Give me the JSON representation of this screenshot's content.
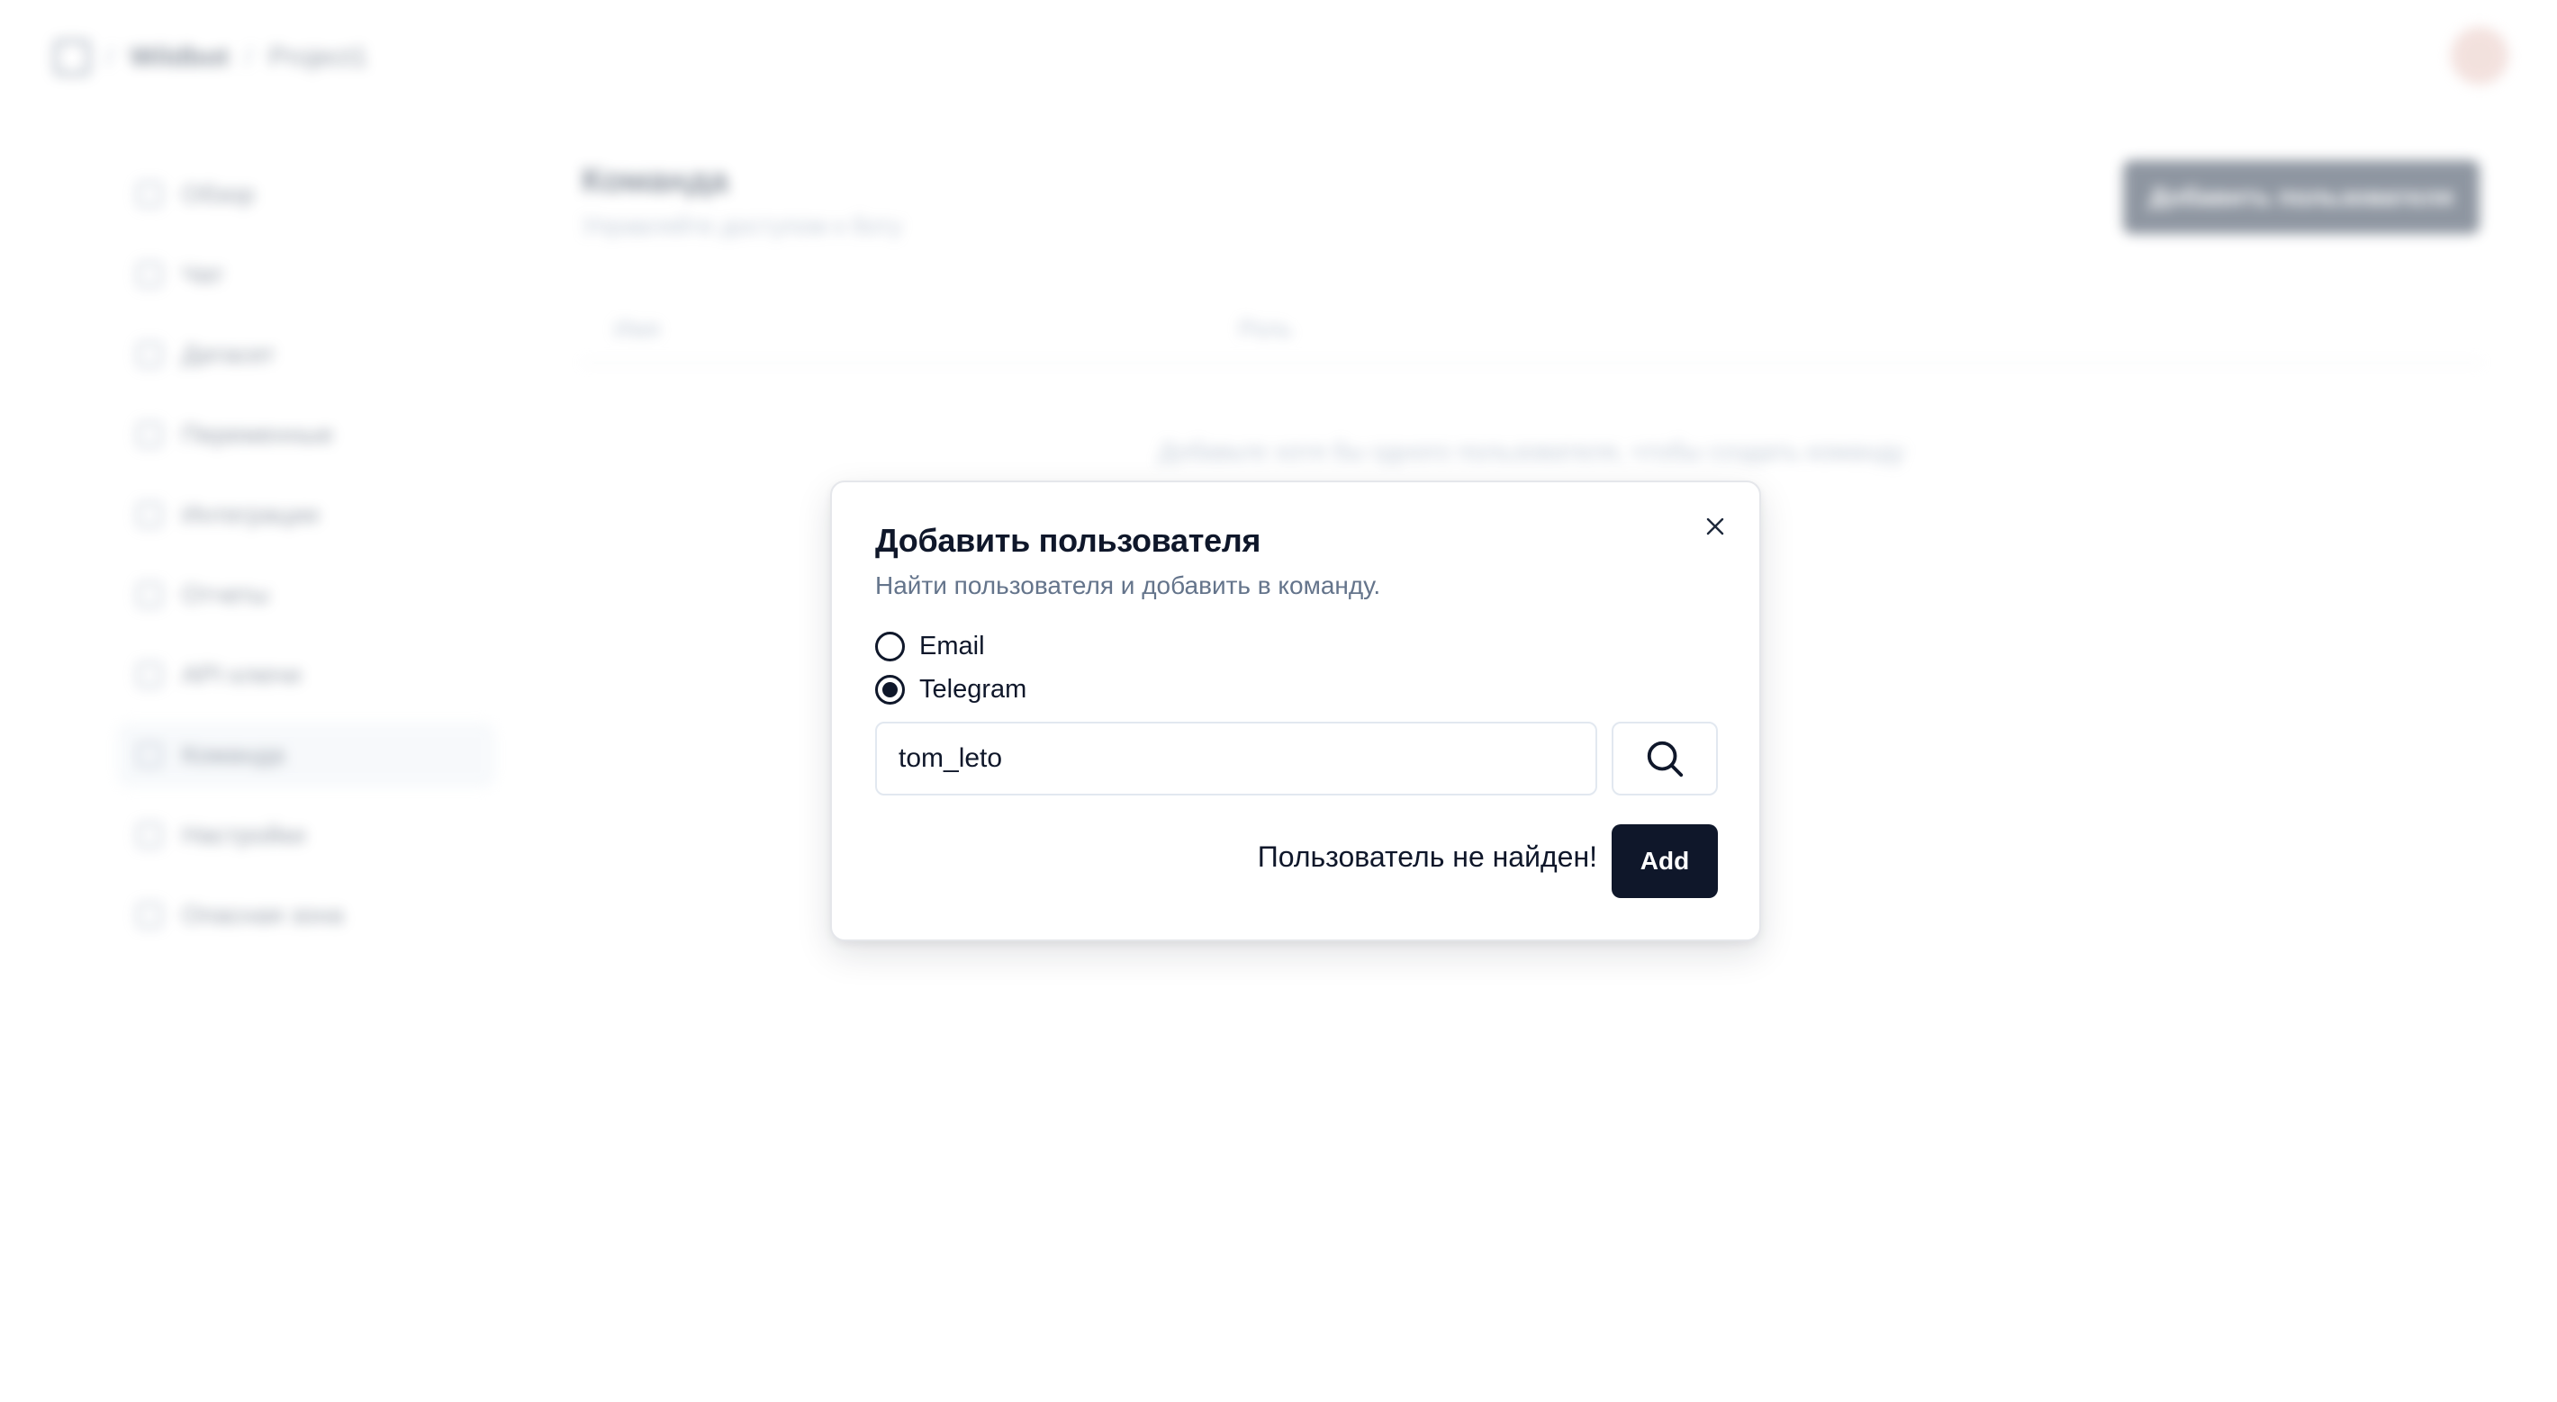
{
  "topbar": {
    "org": "Wildbot",
    "project": "Project1"
  },
  "sidebar": {
    "items": [
      {
        "label": "Обзор",
        "icon": "sparkle-icon"
      },
      {
        "label": "Чат",
        "icon": "chat-icon"
      },
      {
        "label": "Датасет",
        "icon": "dataset-icon"
      },
      {
        "label": "Переменные",
        "icon": "variables-icon"
      },
      {
        "label": "Интеграции",
        "icon": "plug-icon"
      },
      {
        "label": "Отчеты",
        "icon": "report-icon"
      },
      {
        "label": "API ключи",
        "icon": "key-icon"
      },
      {
        "label": "Команда",
        "icon": "team-icon",
        "active": true
      },
      {
        "label": "Настройки",
        "icon": "settings-icon"
      },
      {
        "label": "Опасная зона",
        "icon": "warning-icon"
      }
    ]
  },
  "main": {
    "title": "Команда",
    "subtitle": "Управляйте доступом к боту",
    "add_user_button": "Добавить пользователя",
    "columns": [
      "Имя",
      "Роль"
    ],
    "empty_message": "Добавьте хотя бы одного пользователя, чтобы создать команду"
  },
  "dialog": {
    "title": "Добавить пользователя",
    "description": "Найти пользователя и добавить в команду.",
    "options": [
      {
        "label": "Email",
        "selected": false
      },
      {
        "label": "Telegram",
        "selected": true
      }
    ],
    "search_value": "tom_leto",
    "status": "Пользователь не найден!",
    "add_label": "Add"
  },
  "colors": {
    "primary": "#0f172a",
    "muted": "#64748b",
    "border": "#e2e8f0"
  }
}
